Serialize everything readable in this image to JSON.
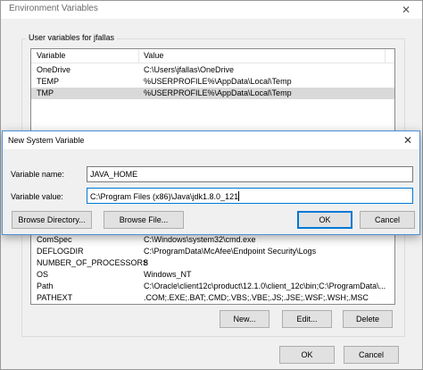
{
  "env_window": {
    "title": "Environment Variables",
    "close_glyph": "✕",
    "user_vars_label": "User variables for jfallas",
    "user_vars_columns": [
      "Variable",
      "Value"
    ],
    "user_vars_rows": [
      {
        "variable": "OneDrive",
        "value": "C:\\Users\\jfallas\\OneDrive"
      },
      {
        "variable": "TEMP",
        "value": "%USERPROFILE%\\AppData\\Local\\Temp"
      },
      {
        "variable": "TMP",
        "value": "%USERPROFILE%\\AppData\\Local\\Temp"
      }
    ],
    "user_vars_selected_index": 2,
    "system_vars_rows": [
      {
        "variable": "ComSpec",
        "value": "C:\\Windows\\system32\\cmd.exe"
      },
      {
        "variable": "DEFLOGDIR",
        "value": "C:\\ProgramData\\McAfee\\Endpoint Security\\Logs"
      },
      {
        "variable": "NUMBER_OF_PROCESSORS",
        "value": "8"
      },
      {
        "variable": "OS",
        "value": "Windows_NT"
      },
      {
        "variable": "Path",
        "value": "C:\\Oracle\\client12c\\product\\12.1.0\\client_12c\\bin;C:\\ProgramData\\..."
      },
      {
        "variable": "PATHEXT",
        "value": ".COM;.EXE;.BAT;.CMD;.VBS;.VBE;.JS;.JSE;.WSF;.WSH;.MSC"
      }
    ],
    "system_buttons": {
      "new": "New...",
      "edit": "Edit...",
      "delete": "Delete"
    },
    "footer_buttons": {
      "ok": "OK",
      "cancel": "Cancel"
    }
  },
  "dialog": {
    "title": "New System Variable",
    "close_glyph": "✕",
    "name_label": "Variable name:",
    "name_value": "JAVA_HOME",
    "value_label": "Variable value:",
    "value_value": "C:\\Program Files (x86)\\Java\\jdk1.8.0_121",
    "browse_directory": "Browse Directory...",
    "browse_file": "Browse File...",
    "ok": "OK",
    "cancel": "Cancel"
  },
  "colors": {
    "accent": "#0078d7",
    "window_bg": "#f0f0f0",
    "selected_row": "#d9d9d9"
  }
}
